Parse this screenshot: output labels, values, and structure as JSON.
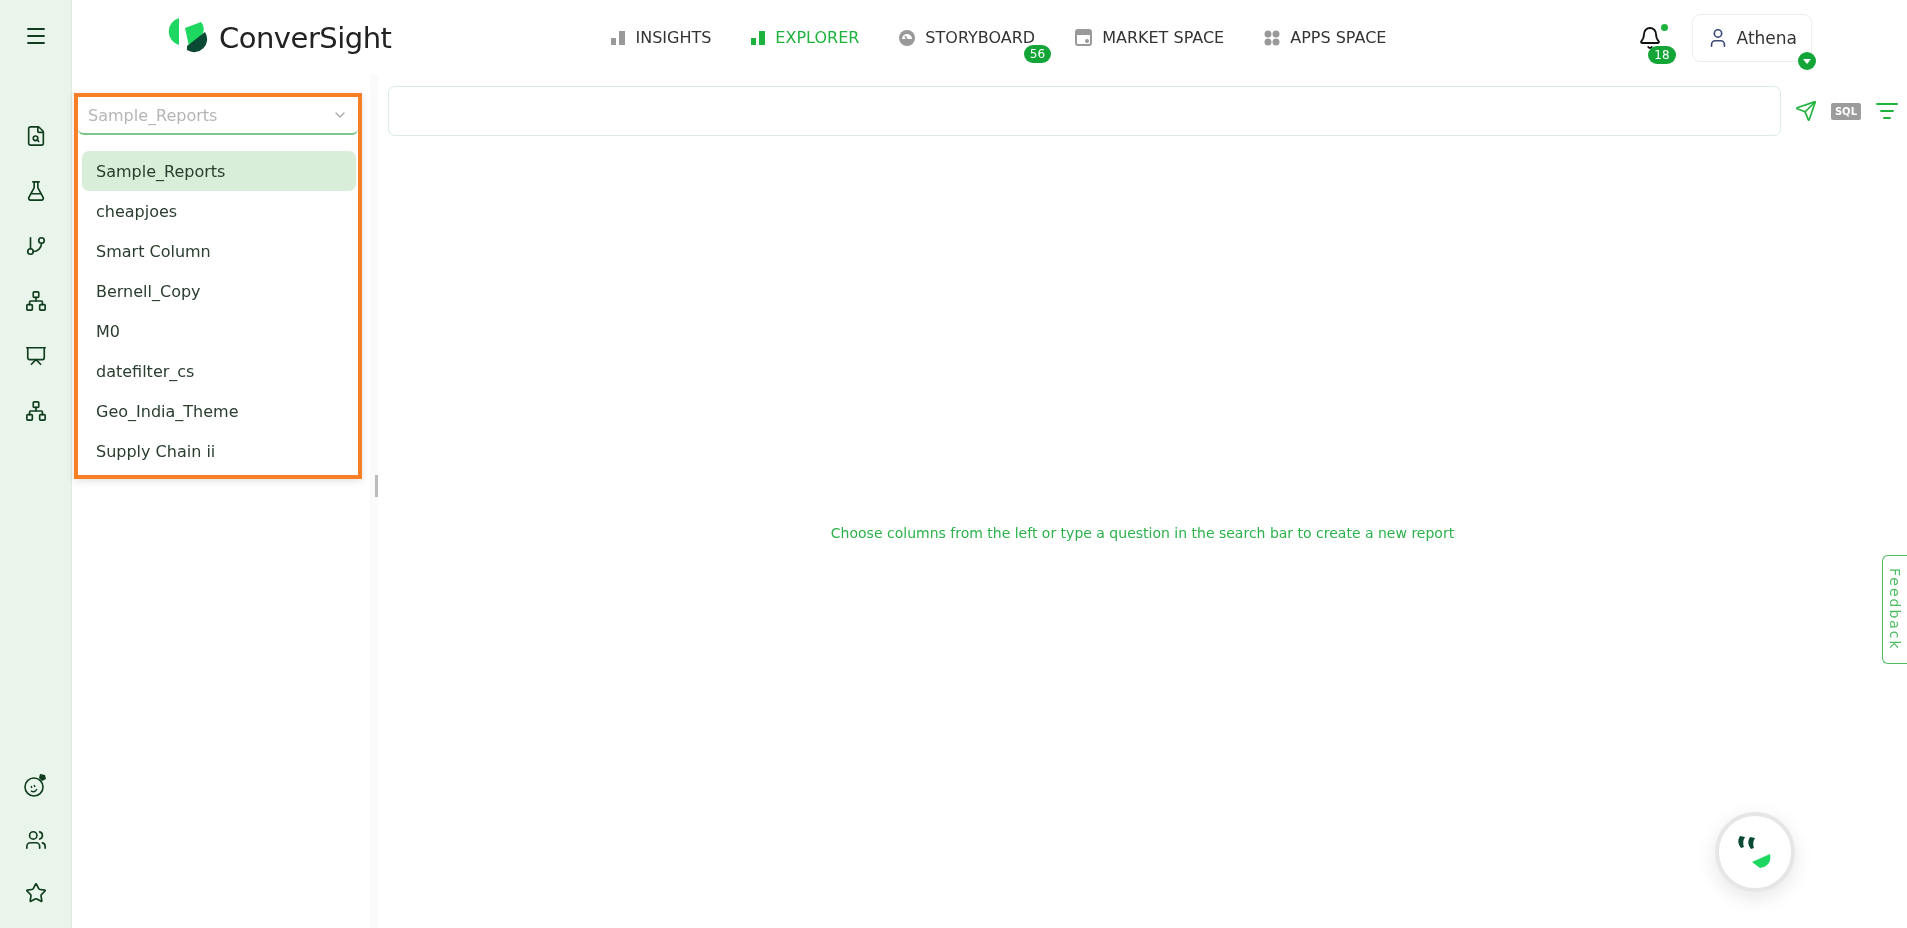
{
  "header": {
    "brand": "ConverSight",
    "nav": [
      {
        "label": "INSIGHTS",
        "kind": "bars",
        "selected": false
      },
      {
        "label": "EXPLORER",
        "kind": "bars",
        "selected": true
      },
      {
        "label": "STORYBOARD",
        "kind": "gauge",
        "selected": false,
        "badge": "56"
      },
      {
        "label": "MARKET SPACE",
        "kind": "store",
        "selected": false
      },
      {
        "label": "APPS SPACE",
        "kind": "dots",
        "selected": false
      }
    ],
    "notifications": {
      "count": "18",
      "unread": true
    },
    "user": "Athena"
  },
  "dataset_select": {
    "value": "Sample_Reports",
    "expanded": true,
    "options": [
      {
        "label": "Sample_Reports",
        "selected": true
      },
      {
        "label": "cheapjoes",
        "selected": false
      },
      {
        "label": "Smart Column",
        "selected": false
      },
      {
        "label": "Bernell_Copy",
        "selected": false
      },
      {
        "label": "M0",
        "selected": false
      },
      {
        "label": "datefilter_cs",
        "selected": false
      },
      {
        "label": "Geo_India_Theme",
        "selected": false
      },
      {
        "label": "Supply Chain ii",
        "selected": false
      }
    ]
  },
  "search": {
    "sql_label": "SQL"
  },
  "empty_message": "Choose columns from the left or type a question in the search bar to create a new report",
  "feedback": "Feedback"
}
